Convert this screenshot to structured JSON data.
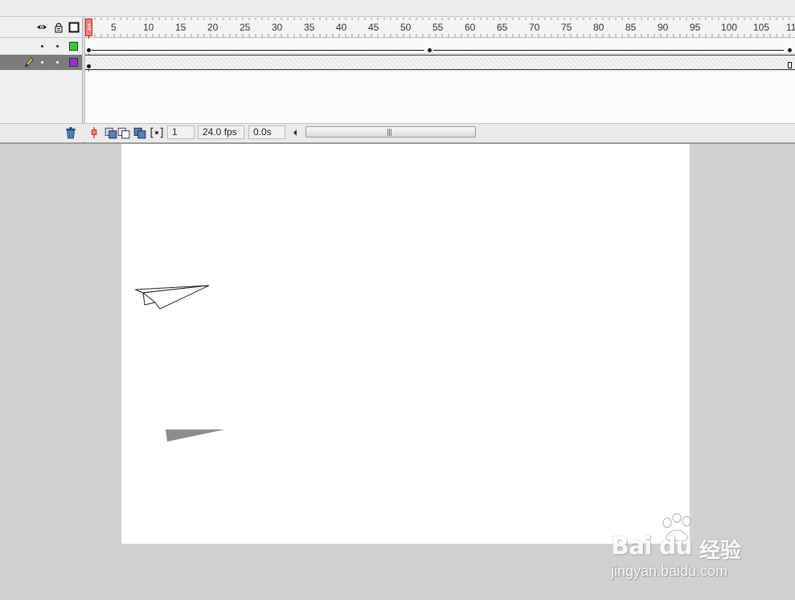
{
  "timeline": {
    "ruler_labels": [
      "1",
      "5",
      "10",
      "15",
      "20",
      "25",
      "30",
      "35",
      "40",
      "45",
      "50",
      "55",
      "60",
      "65",
      "70",
      "75",
      "80",
      "85",
      "90",
      "95",
      "100",
      "105",
      "11"
    ],
    "current_frame": "1",
    "frame_rate": "24.0 fps",
    "elapsed_time": "0.0s",
    "header_icons": [
      "eye-icon",
      "lock-icon",
      "outline-icon"
    ],
    "layers": [
      {
        "name": "",
        "outline_color": "#33cc33",
        "selected": false
      },
      {
        "name": "",
        "outline_color": "#9933cc",
        "selected": true
      }
    ],
    "toolbar_icons": [
      "trash-icon",
      "center-frame-icon",
      "onion-skin-icon",
      "onion-skin-outlines-icon",
      "edit-multiple-frames-icon",
      "modify-onion-markers-icon"
    ]
  },
  "stage": {
    "background": "#ffffff",
    "objects": [
      "paper-plane",
      "plane-shadow"
    ]
  },
  "watermark": {
    "logo": "Bai du",
    "chinese": "经验",
    "url": "jingyan.baidu.com"
  }
}
